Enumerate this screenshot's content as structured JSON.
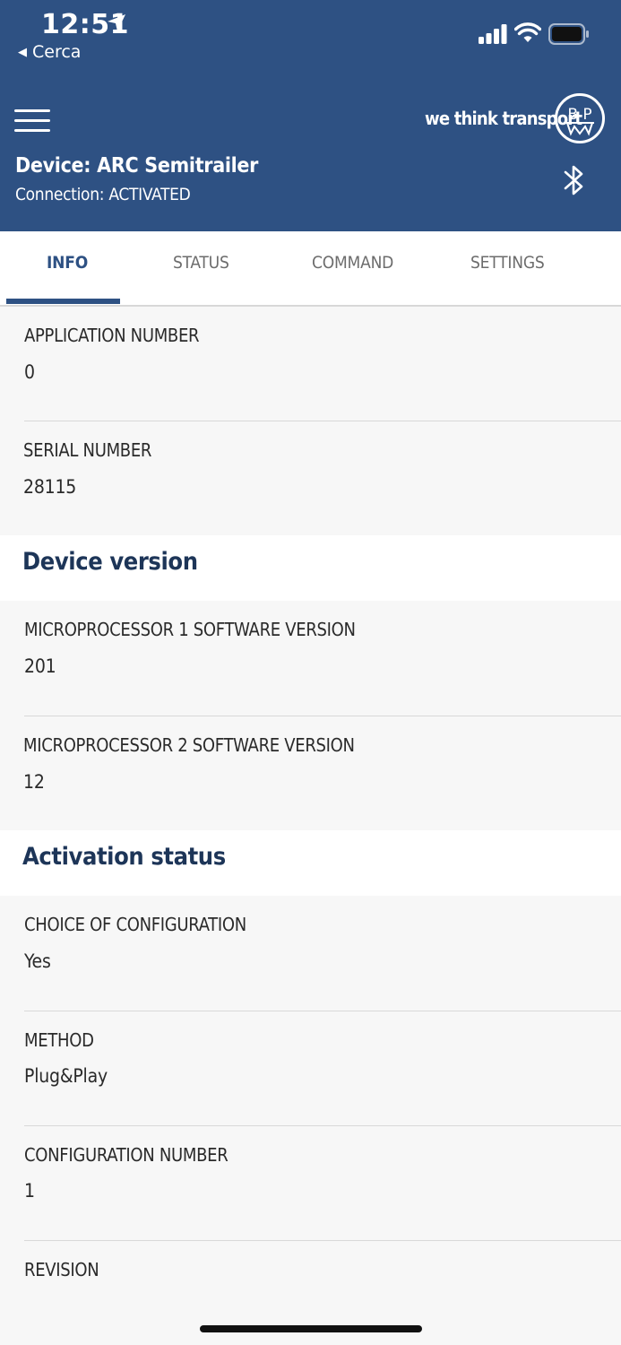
{
  "status_bar": {
    "time": "12:51",
    "back_label": "Cerca"
  },
  "header": {
    "brand_text": "we think transport",
    "logo_text": "BPW",
    "device_label": "Device: ARC Semitrailer",
    "connection_label": "Connection: ACTIVATED"
  },
  "tabs": [
    {
      "label": "INFO",
      "active": true
    },
    {
      "label": "STATUS",
      "active": false
    },
    {
      "label": "COMMAND",
      "active": false
    },
    {
      "label": "SETTINGS",
      "active": false
    }
  ],
  "info": {
    "application_number": {
      "label": "APPLICATION NUMBER",
      "value": "0"
    },
    "serial_number": {
      "label": "SERIAL NUMBER",
      "value": "28115"
    }
  },
  "device_version": {
    "title": "Device version",
    "micro1": {
      "label": "MICROPROCESSOR 1 SOFTWARE VERSION",
      "value": "201"
    },
    "micro2": {
      "label": "MICROPROCESSOR 2 SOFTWARE VERSION",
      "value": "12"
    }
  },
  "activation_status": {
    "title": "Activation status",
    "choice": {
      "label": "CHOICE OF CONFIGURATION",
      "value": "Yes"
    },
    "method": {
      "label": "METHOD",
      "value": "Plug&Play"
    },
    "config_number": {
      "label": "CONFIGURATION NUMBER",
      "value": "1"
    },
    "revision": {
      "label": "REVISION",
      "value": ""
    }
  },
  "colors": {
    "header_bg": "#2e5183",
    "accent": "#2e5183",
    "section_title": "#1d3558"
  }
}
